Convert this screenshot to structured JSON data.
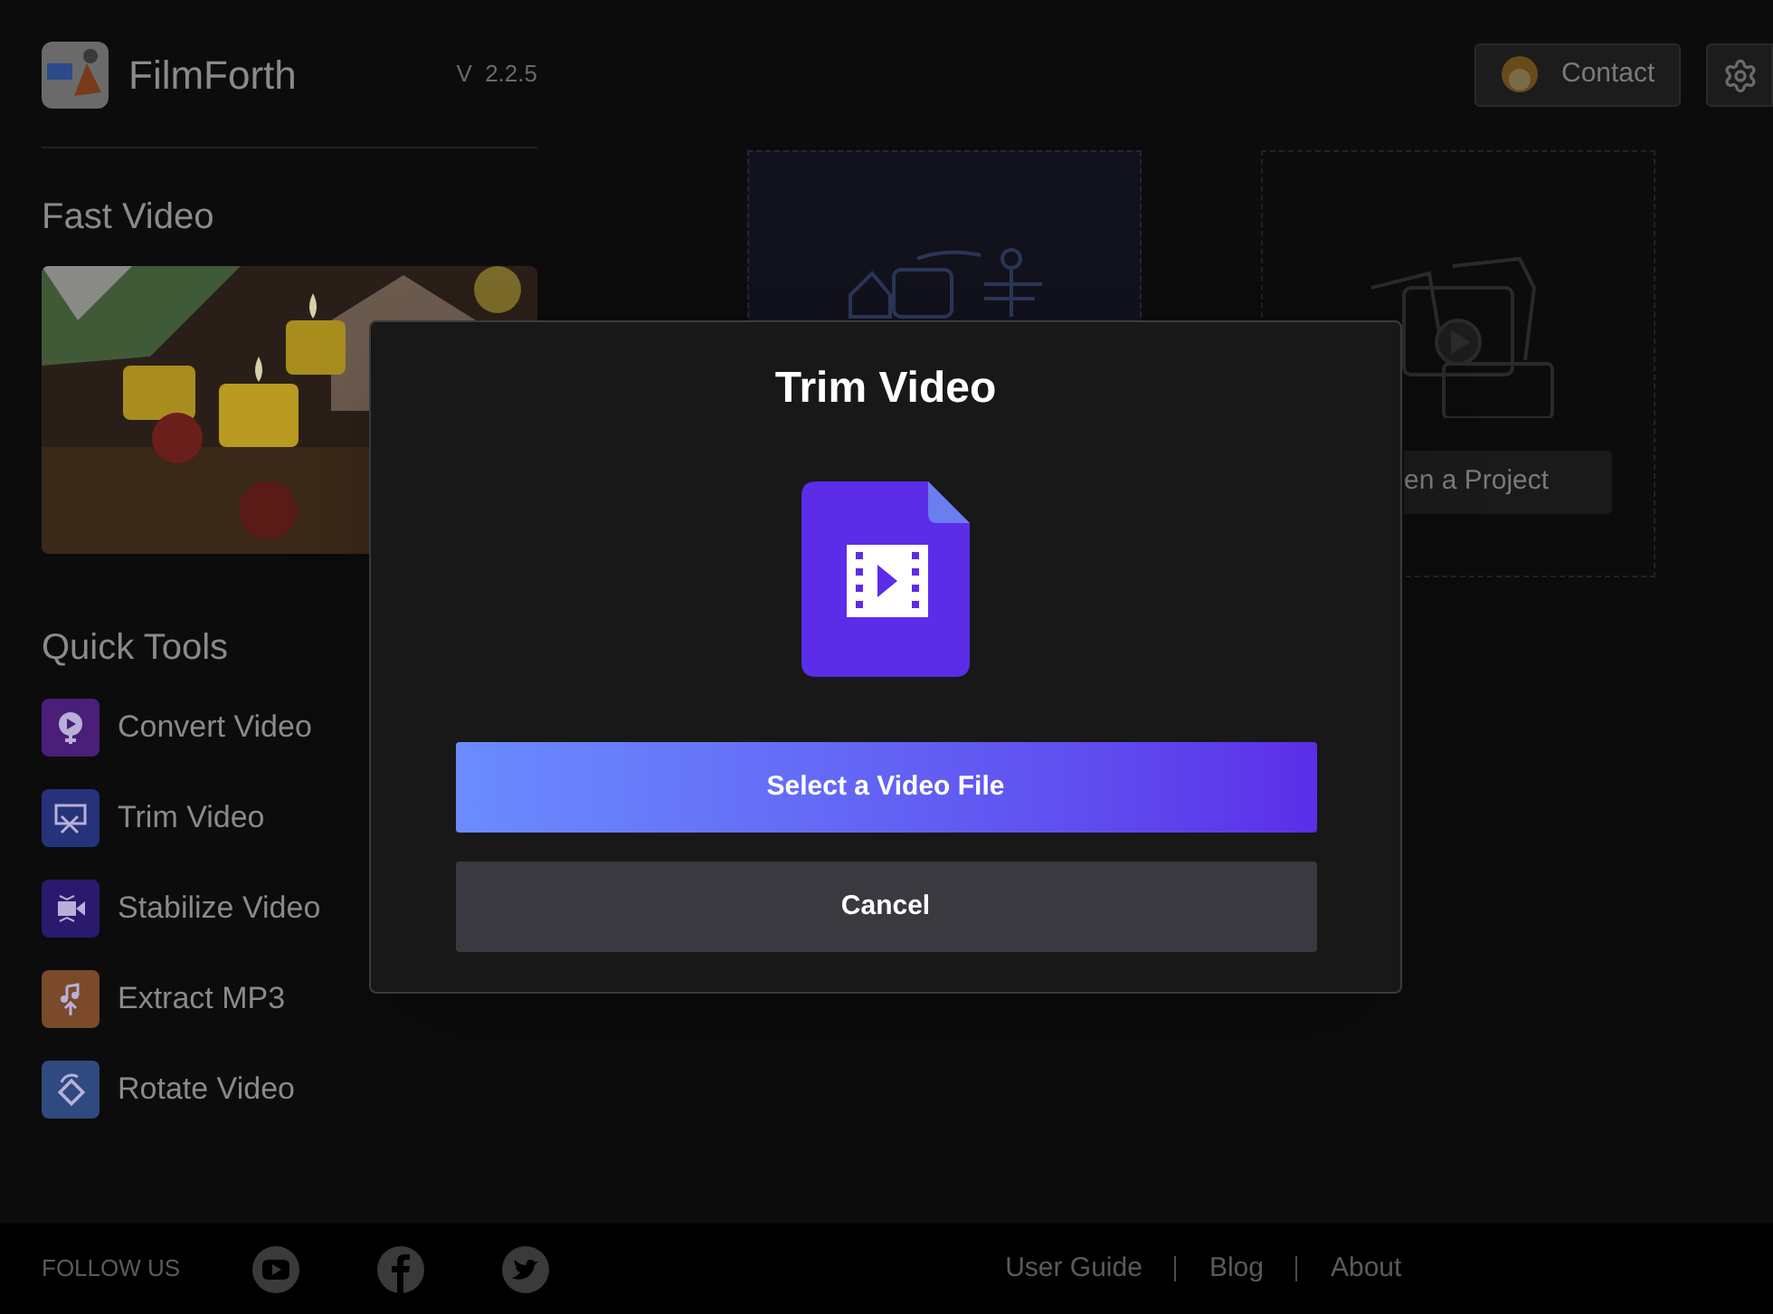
{
  "app": {
    "name": "FilmForth",
    "version": "V  2.2.5"
  },
  "header": {
    "contact": "Contact"
  },
  "sidebar": {
    "fast_video": {
      "title": "Fast Video"
    },
    "quick_tools": {
      "title": "Quick Tools",
      "items": [
        {
          "label": "Convert Video",
          "kind": "convert",
          "color": "#4a1f7a"
        },
        {
          "label": "Trim Video",
          "kind": "trim",
          "color": "#26337a"
        },
        {
          "label": "Stabilize Video",
          "kind": "stabilize",
          "color": "#2a1a6e"
        },
        {
          "label": "Extract MP3",
          "kind": "extract",
          "color": "#7a4a2a"
        },
        {
          "label": "Rotate Video",
          "kind": "rotate",
          "color": "#2e4a80"
        }
      ]
    }
  },
  "cards": [
    {
      "kind": "new"
    },
    {
      "kind": "open",
      "button": "en a Project"
    }
  ],
  "dialog": {
    "title": "Trim Video",
    "primary": "Select a Video File",
    "secondary": "Cancel"
  },
  "footer": {
    "follow": "FOLLOW US",
    "social": [
      {
        "kind": "youtube"
      },
      {
        "kind": "facebook"
      },
      {
        "kind": "twitter"
      }
    ],
    "links": [
      "User Guide",
      "Blog",
      "About"
    ]
  }
}
